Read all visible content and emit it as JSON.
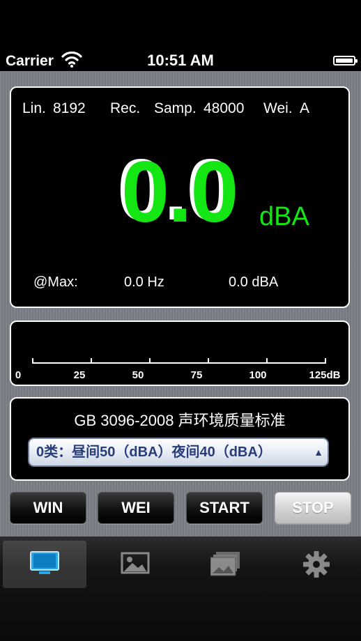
{
  "status_bar": {
    "carrier": "Carrier",
    "time": "10:51 AM"
  },
  "display": {
    "lin_label": "Lin.",
    "lin_value": "8192",
    "rec_label": "Rec.",
    "samp_label": "Samp.",
    "samp_value": "48000",
    "wei_label": "Wei.",
    "wei_value": "A",
    "level_value": "0.0",
    "level_unit": "dBA",
    "max_label": "@Max:",
    "max_freq": "0.0 Hz",
    "max_level": "0.0 dBA"
  },
  "scale": {
    "labels": [
      "0",
      "25",
      "50",
      "75",
      "100",
      "125dB"
    ]
  },
  "standard": {
    "title": "GB 3096-2008 声环境质量标准",
    "selected_option": "0类：昼间50（dBA）夜间40（dBA）"
  },
  "buttons": {
    "win": "WIN",
    "wei": "WEI",
    "start": "START",
    "stop": "STOP"
  },
  "tabbar": {
    "icons": [
      "monitor-icon",
      "image-icon",
      "gallery-icon",
      "settings-gear-icon"
    ],
    "active_index": 0
  },
  "colors": {
    "level_green": "#14e614",
    "select_text": "#273d7a",
    "background_gray": "#7b7e86"
  }
}
